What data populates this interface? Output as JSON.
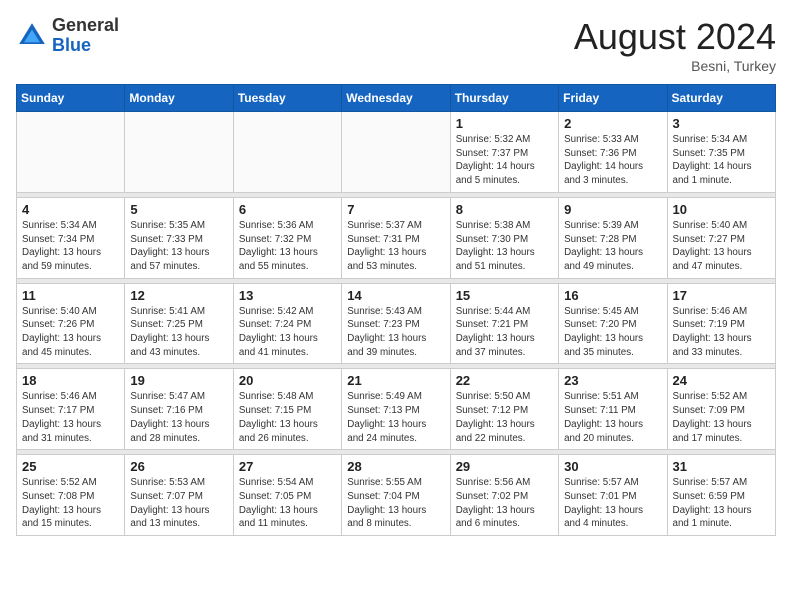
{
  "header": {
    "logo_general": "General",
    "logo_blue": "Blue",
    "month_year": "August 2024",
    "location": "Besni, Turkey"
  },
  "days_of_week": [
    "Sunday",
    "Monday",
    "Tuesday",
    "Wednesday",
    "Thursday",
    "Friday",
    "Saturday"
  ],
  "weeks": [
    [
      {
        "day": "",
        "info": ""
      },
      {
        "day": "",
        "info": ""
      },
      {
        "day": "",
        "info": ""
      },
      {
        "day": "",
        "info": ""
      },
      {
        "day": "1",
        "info": "Sunrise: 5:32 AM\nSunset: 7:37 PM\nDaylight: 14 hours\nand 5 minutes."
      },
      {
        "day": "2",
        "info": "Sunrise: 5:33 AM\nSunset: 7:36 PM\nDaylight: 14 hours\nand 3 minutes."
      },
      {
        "day": "3",
        "info": "Sunrise: 5:34 AM\nSunset: 7:35 PM\nDaylight: 14 hours\nand 1 minute."
      }
    ],
    [
      {
        "day": "4",
        "info": "Sunrise: 5:34 AM\nSunset: 7:34 PM\nDaylight: 13 hours\nand 59 minutes."
      },
      {
        "day": "5",
        "info": "Sunrise: 5:35 AM\nSunset: 7:33 PM\nDaylight: 13 hours\nand 57 minutes."
      },
      {
        "day": "6",
        "info": "Sunrise: 5:36 AM\nSunset: 7:32 PM\nDaylight: 13 hours\nand 55 minutes."
      },
      {
        "day": "7",
        "info": "Sunrise: 5:37 AM\nSunset: 7:31 PM\nDaylight: 13 hours\nand 53 minutes."
      },
      {
        "day": "8",
        "info": "Sunrise: 5:38 AM\nSunset: 7:30 PM\nDaylight: 13 hours\nand 51 minutes."
      },
      {
        "day": "9",
        "info": "Sunrise: 5:39 AM\nSunset: 7:28 PM\nDaylight: 13 hours\nand 49 minutes."
      },
      {
        "day": "10",
        "info": "Sunrise: 5:40 AM\nSunset: 7:27 PM\nDaylight: 13 hours\nand 47 minutes."
      }
    ],
    [
      {
        "day": "11",
        "info": "Sunrise: 5:40 AM\nSunset: 7:26 PM\nDaylight: 13 hours\nand 45 minutes."
      },
      {
        "day": "12",
        "info": "Sunrise: 5:41 AM\nSunset: 7:25 PM\nDaylight: 13 hours\nand 43 minutes."
      },
      {
        "day": "13",
        "info": "Sunrise: 5:42 AM\nSunset: 7:24 PM\nDaylight: 13 hours\nand 41 minutes."
      },
      {
        "day": "14",
        "info": "Sunrise: 5:43 AM\nSunset: 7:23 PM\nDaylight: 13 hours\nand 39 minutes."
      },
      {
        "day": "15",
        "info": "Sunrise: 5:44 AM\nSunset: 7:21 PM\nDaylight: 13 hours\nand 37 minutes."
      },
      {
        "day": "16",
        "info": "Sunrise: 5:45 AM\nSunset: 7:20 PM\nDaylight: 13 hours\nand 35 minutes."
      },
      {
        "day": "17",
        "info": "Sunrise: 5:46 AM\nSunset: 7:19 PM\nDaylight: 13 hours\nand 33 minutes."
      }
    ],
    [
      {
        "day": "18",
        "info": "Sunrise: 5:46 AM\nSunset: 7:17 PM\nDaylight: 13 hours\nand 31 minutes."
      },
      {
        "day": "19",
        "info": "Sunrise: 5:47 AM\nSunset: 7:16 PM\nDaylight: 13 hours\nand 28 minutes."
      },
      {
        "day": "20",
        "info": "Sunrise: 5:48 AM\nSunset: 7:15 PM\nDaylight: 13 hours\nand 26 minutes."
      },
      {
        "day": "21",
        "info": "Sunrise: 5:49 AM\nSunset: 7:13 PM\nDaylight: 13 hours\nand 24 minutes."
      },
      {
        "day": "22",
        "info": "Sunrise: 5:50 AM\nSunset: 7:12 PM\nDaylight: 13 hours\nand 22 minutes."
      },
      {
        "day": "23",
        "info": "Sunrise: 5:51 AM\nSunset: 7:11 PM\nDaylight: 13 hours\nand 20 minutes."
      },
      {
        "day": "24",
        "info": "Sunrise: 5:52 AM\nSunset: 7:09 PM\nDaylight: 13 hours\nand 17 minutes."
      }
    ],
    [
      {
        "day": "25",
        "info": "Sunrise: 5:52 AM\nSunset: 7:08 PM\nDaylight: 13 hours\nand 15 minutes."
      },
      {
        "day": "26",
        "info": "Sunrise: 5:53 AM\nSunset: 7:07 PM\nDaylight: 13 hours\nand 13 minutes."
      },
      {
        "day": "27",
        "info": "Sunrise: 5:54 AM\nSunset: 7:05 PM\nDaylight: 13 hours\nand 11 minutes."
      },
      {
        "day": "28",
        "info": "Sunrise: 5:55 AM\nSunset: 7:04 PM\nDaylight: 13 hours\nand 8 minutes."
      },
      {
        "day": "29",
        "info": "Sunrise: 5:56 AM\nSunset: 7:02 PM\nDaylight: 13 hours\nand 6 minutes."
      },
      {
        "day": "30",
        "info": "Sunrise: 5:57 AM\nSunset: 7:01 PM\nDaylight: 13 hours\nand 4 minutes."
      },
      {
        "day": "31",
        "info": "Sunrise: 5:57 AM\nSunset: 6:59 PM\nDaylight: 13 hours\nand 1 minute."
      }
    ]
  ]
}
